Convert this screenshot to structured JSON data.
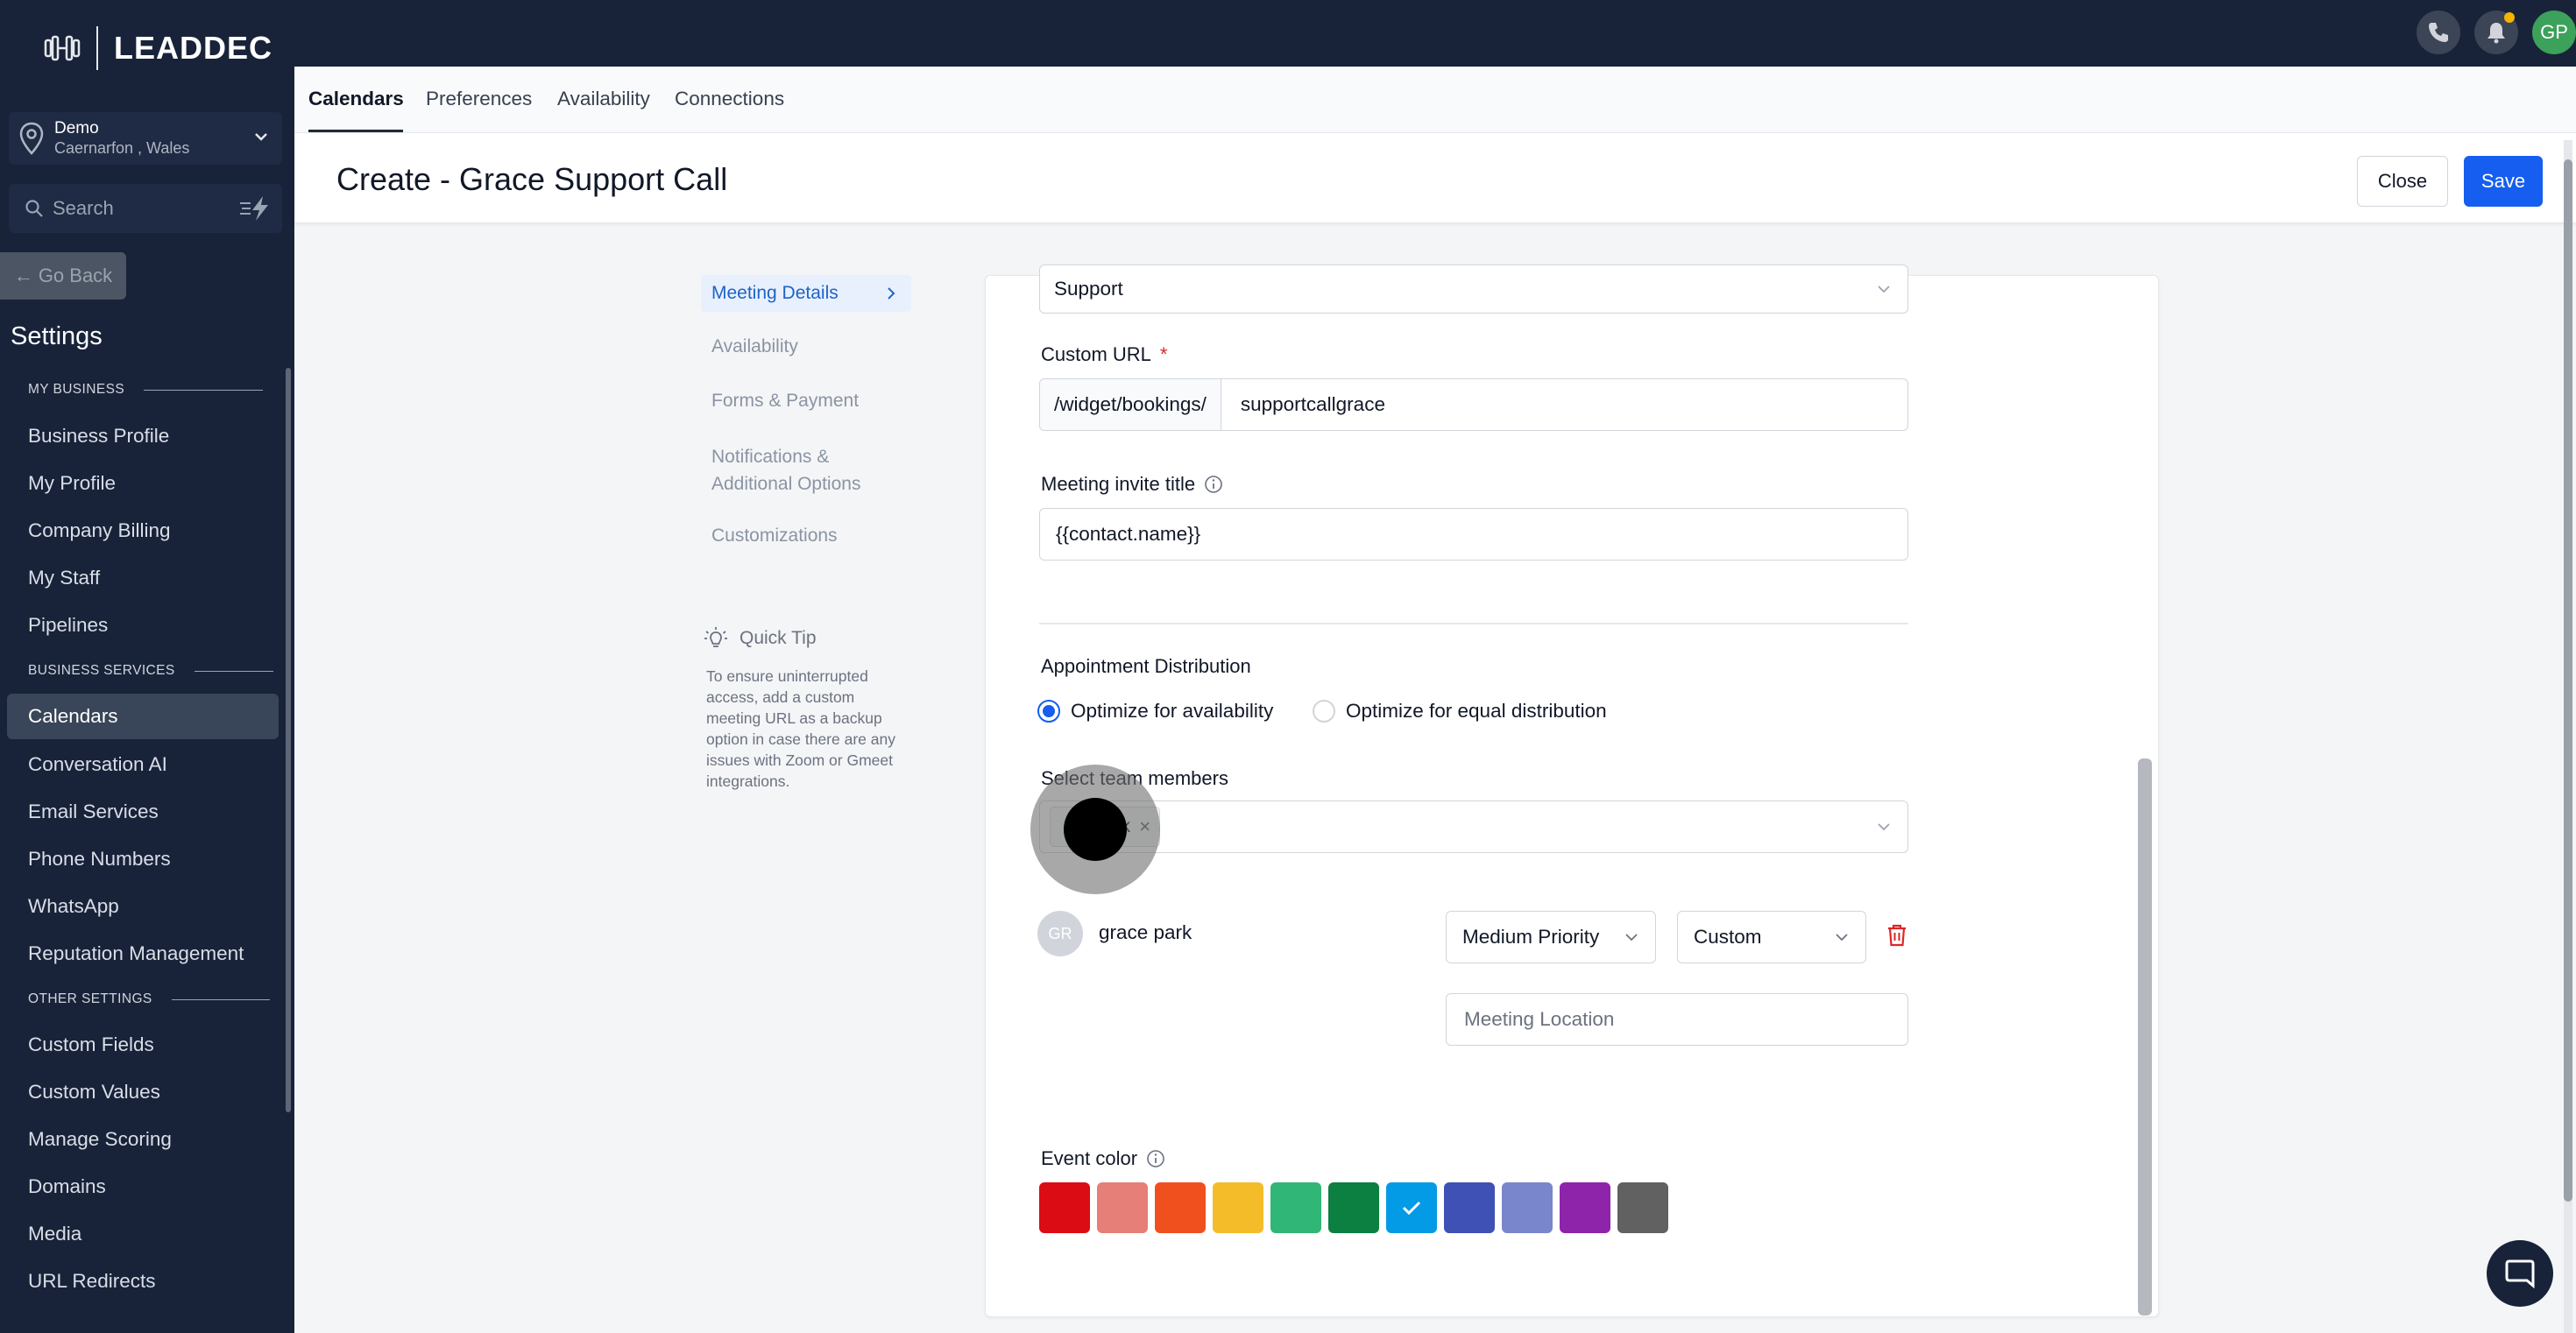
{
  "brand": {
    "logo_text": "LEADDEC"
  },
  "location": {
    "name": "Demo",
    "sub": "Caernarfon , Wales"
  },
  "search": {
    "placeholder": "Search"
  },
  "sidebar": {
    "go_back": "Go Back",
    "title": "Settings",
    "sections": {
      "my_business": "MY BUSINESS",
      "business_services": "BUSINESS SERVICES",
      "other_settings": "OTHER SETTINGS"
    },
    "items": [
      "Business Profile",
      "My Profile",
      "Company Billing",
      "My Staff",
      "Pipelines",
      "Calendars",
      "Conversation AI",
      "Email Services",
      "Phone Numbers",
      "WhatsApp",
      "Reputation Management",
      "Custom Fields",
      "Custom Values",
      "Manage Scoring",
      "Domains",
      "Media",
      "URL Redirects"
    ],
    "active_item": "Calendars"
  },
  "topbar": {
    "avatar_initials": "GP"
  },
  "tabs": [
    "Calendars",
    "Preferences",
    "Availability",
    "Connections"
  ],
  "header": {
    "title": "Create - Grace Support Call",
    "close_label": "Close",
    "save_label": "Save"
  },
  "steps": [
    "Meeting Details",
    "Availability",
    "Forms & Payment",
    "Notifications & Additional Options",
    "Customizations"
  ],
  "quick_tip": {
    "title": "Quick Tip",
    "text": "To ensure uninterrupted access, add a custom meeting URL as a backup option in case there are any issues with Zoom or Gmeet integrations."
  },
  "form": {
    "group_value": "Support",
    "custom_url_label": "Custom URL",
    "required_mark": "*",
    "url_prefix": "/widget/bookings/",
    "url_value": "supportcallgrace",
    "invite_title_label": "Meeting invite title",
    "invite_title_value": "{{contact.name}}",
    "distribution_label": "Appointment Distribution",
    "distribution_options": [
      "Optimize for availability",
      "Optimize for equal distribution"
    ],
    "distribution_selected": "Optimize for availability",
    "team_members_label": "Select team members",
    "chip_text": "ark",
    "member": {
      "initials": "GR",
      "name": "grace park",
      "priority": "Medium Priority",
      "availability": "Custom",
      "location_placeholder": "Meeting Location"
    },
    "event_color_label": "Event color",
    "colors": [
      "#dc0c14",
      "#e57f77",
      "#f0501e",
      "#f5bc2a",
      "#30b676",
      "#0b8041",
      "#039be5",
      "#3f51b5",
      "#7986cb",
      "#8e24aa",
      "#616161"
    ],
    "selected_color": "#039be5"
  }
}
